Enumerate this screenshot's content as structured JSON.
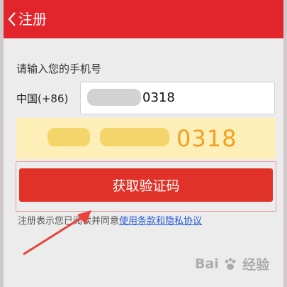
{
  "header": {
    "title": "注册"
  },
  "form": {
    "prompt": "请输入您的手机号",
    "country_code": "中国(+86)",
    "phone_visible_suffix": "0318",
    "magnifier_visible_suffix": "0318",
    "get_code_button": "获取验证码"
  },
  "terms": {
    "prefix": "注册表示您已阅读并同意",
    "link": "使用条款和隐私协议"
  },
  "watermark": {
    "brand_left": "Bai",
    "brand_right": "经验"
  },
  "colors": {
    "header_bg": "#e2242b",
    "button_bg": "#e03228",
    "link": "#2a5bd7",
    "magnifier_bg": "#fdefb7",
    "magnifier_text": "#f1a020"
  },
  "icons": {
    "back": "chevron-left-icon",
    "annotation": "red-arrow-icon",
    "watermark": "baidu-paw-icon"
  }
}
